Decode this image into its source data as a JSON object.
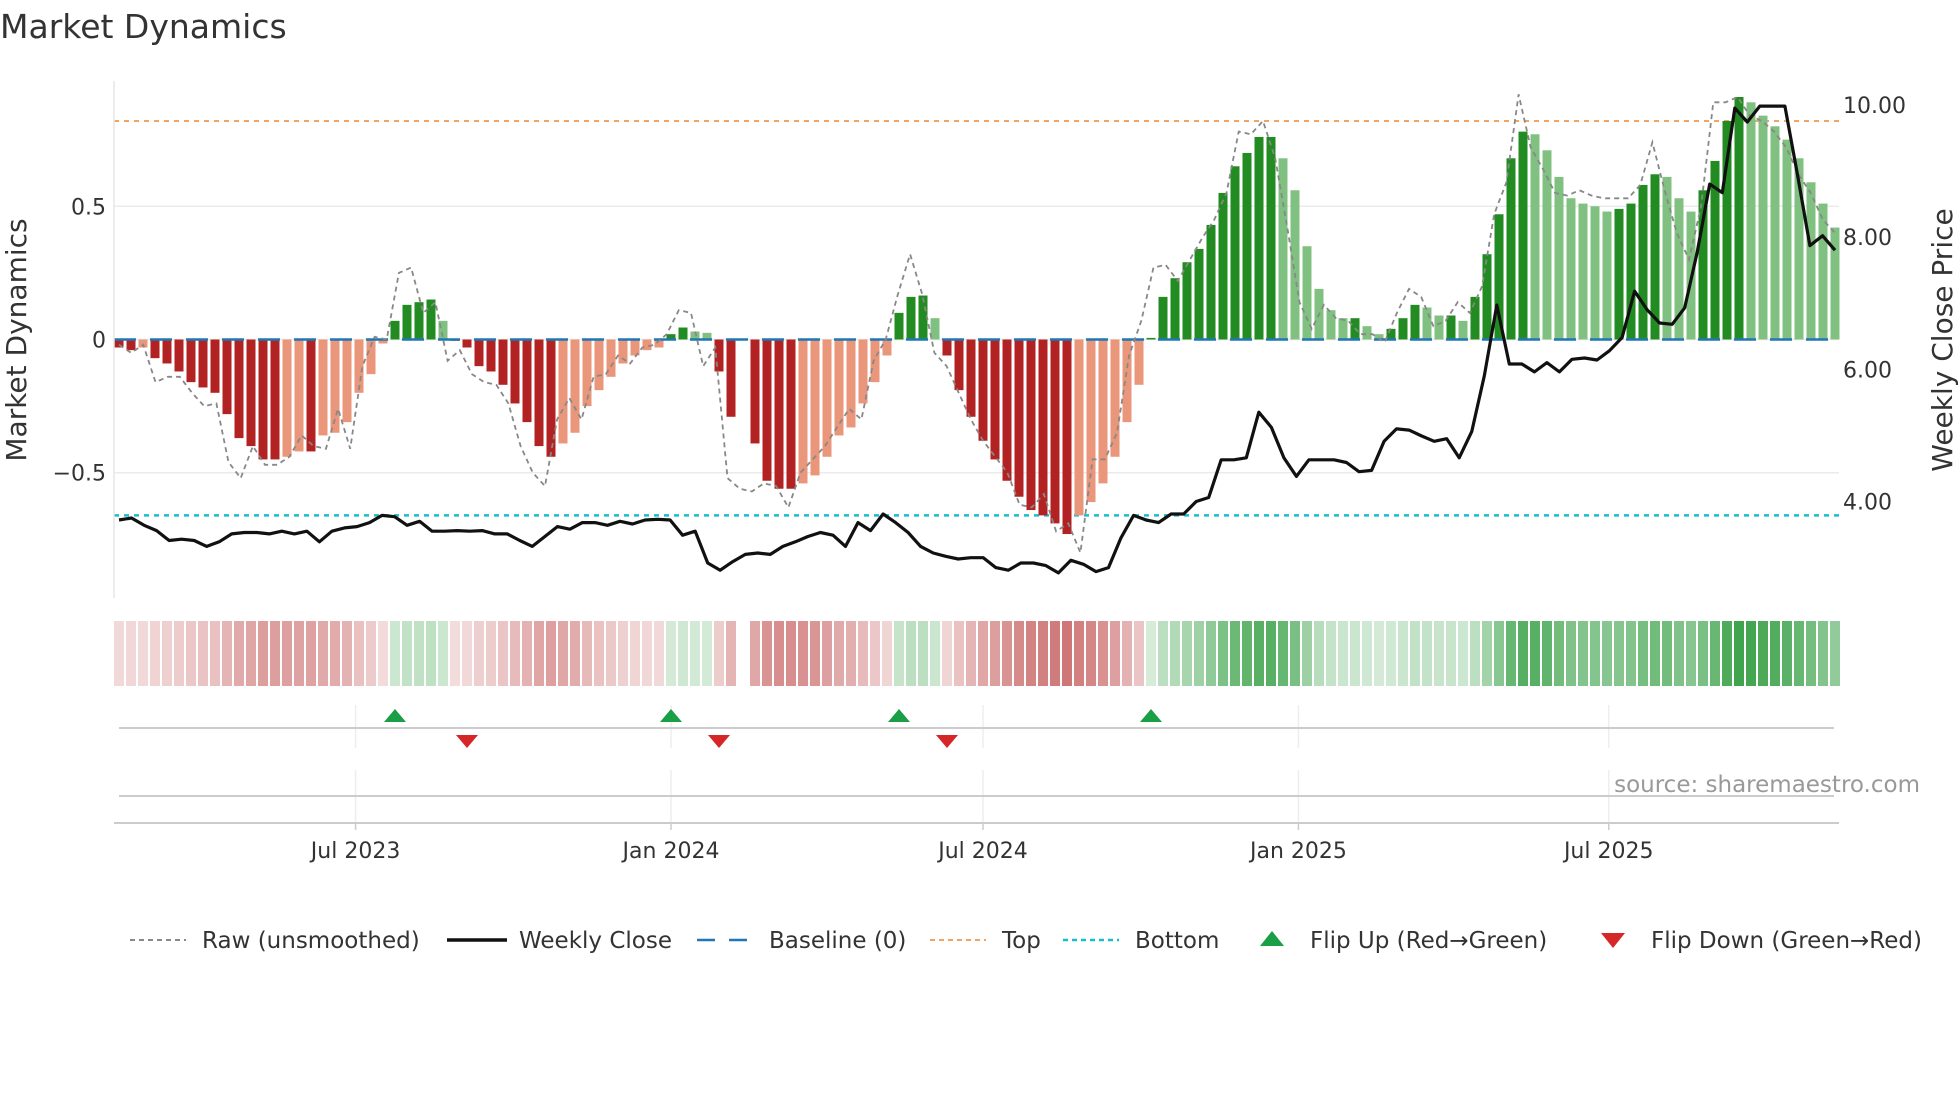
{
  "chart_data": {
    "type": "bar",
    "title": "Market Dynamics",
    "ylabel": "Market Dynamics",
    "y2label": "Weekly Close Price",
    "ylim": [
      -0.97,
      0.97
    ],
    "y2lim": [
      2.54,
      10.36
    ],
    "yticks": [
      {
        "v": 0.5,
        "label": "0.5"
      },
      {
        "v": 0,
        "label": "0"
      },
      {
        "v": -0.5,
        "label": "−0.5"
      }
    ],
    "y2ticks": [
      {
        "v": 10,
        "label": "10.00"
      },
      {
        "v": 8,
        "label": "8.00"
      },
      {
        "v": 6,
        "label": "6.00"
      },
      {
        "v": 4,
        "label": "4.00"
      }
    ],
    "start_week": "2023-02-13",
    "xticks": [
      {
        "date": "2023-07-01",
        "label": "Jul 2023"
      },
      {
        "date": "2024-01-01",
        "label": "Jan 2024"
      },
      {
        "date": "2024-07-01",
        "label": "Jul 2024"
      },
      {
        "date": "2025-01-01",
        "label": "Jan 2025"
      },
      {
        "date": "2025-07-01",
        "label": "Jul 2025"
      }
    ],
    "top_level": 0.82,
    "bottom_level": -0.66,
    "baseline": 0,
    "smoothed": [
      -0.03,
      -0.04,
      -0.03,
      -0.07,
      -0.09,
      -0.12,
      -0.16,
      -0.18,
      -0.2,
      -0.28,
      -0.37,
      -0.4,
      -0.45,
      -0.45,
      -0.44,
      -0.42,
      -0.42,
      -0.36,
      -0.35,
      -0.31,
      -0.2,
      -0.13,
      -0.015,
      0.07,
      0.13,
      0.14,
      0.15,
      0.07,
      -0.005,
      -0.03,
      -0.1,
      -0.12,
      -0.17,
      -0.24,
      -0.31,
      -0.4,
      -0.44,
      -0.39,
      -0.35,
      -0.25,
      -0.19,
      -0.14,
      -0.09,
      -0.06,
      -0.04,
      -0.03,
      0.02,
      0.045,
      0.03,
      0.025,
      -0.12,
      -0.29,
      null,
      -0.39,
      -0.53,
      -0.56,
      -0.56,
      -0.54,
      -0.51,
      -0.44,
      -0.36,
      -0.33,
      -0.24,
      -0.16,
      -0.06,
      0.1,
      0.16,
      0.165,
      0.08,
      -0.06,
      -0.19,
      -0.29,
      -0.38,
      -0.45,
      -0.53,
      -0.59,
      -0.64,
      -0.66,
      -0.69,
      -0.73,
      -0.66,
      -0.61,
      -0.54,
      -0.44,
      -0.31,
      -0.17,
      0.006,
      0.16,
      0.23,
      0.29,
      0.34,
      0.43,
      0.55,
      0.65,
      0.7,
      0.76,
      0.76,
      0.68,
      0.56,
      0.35,
      0.19,
      0.11,
      0.08,
      0.08,
      0.05,
      0.02,
      0.04,
      0.08,
      0.13,
      0.12,
      0.09,
      0.09,
      0.07,
      0.16,
      0.32,
      0.47,
      0.68,
      0.78,
      0.77,
      0.71,
      0.61,
      0.53,
      0.51,
      0.5,
      0.48,
      0.49,
      0.51,
      0.58,
      0.62,
      0.61,
      0.53,
      0.48,
      0.56,
      0.67,
      0.82,
      0.91,
      0.89,
      0.84,
      0.8,
      0.75,
      0.68,
      0.59,
      0.51,
      0.42
    ],
    "raw": [
      -0.02,
      -0.05,
      -0.02,
      -0.16,
      -0.14,
      -0.14,
      -0.2,
      -0.25,
      -0.24,
      -0.46,
      -0.52,
      -0.4,
      -0.47,
      -0.47,
      -0.44,
      -0.36,
      -0.4,
      -0.41,
      -0.26,
      -0.41,
      -0.1,
      0.01,
      0.0,
      0.25,
      0.27,
      0.1,
      0.14,
      -0.08,
      -0.04,
      -0.13,
      -0.16,
      -0.17,
      -0.24,
      -0.4,
      -0.5,
      -0.55,
      -0.3,
      -0.22,
      -0.3,
      -0.14,
      -0.13,
      -0.06,
      -0.09,
      -0.03,
      -0.02,
      0.02,
      0.11,
      0.1,
      -0.1,
      -0.03,
      -0.52,
      -0.56,
      -0.57,
      -0.54,
      -0.55,
      -0.63,
      -0.5,
      -0.45,
      -0.4,
      -0.33,
      -0.26,
      -0.3,
      -0.08,
      0.0,
      0.17,
      0.32,
      0.17,
      -0.05,
      -0.1,
      -0.2,
      -0.3,
      -0.38,
      -0.44,
      -0.5,
      -0.62,
      -0.63,
      -0.58,
      -0.72,
      -0.69,
      -0.8,
      -0.45,
      -0.45,
      -0.35,
      -0.06,
      0.07,
      0.27,
      0.28,
      0.22,
      0.3,
      0.38,
      0.45,
      0.55,
      0.78,
      0.77,
      0.82,
      0.68,
      0.42,
      0.14,
      0.04,
      0.13,
      0.08,
      0.07,
      0.02,
      0.02,
      -0.01,
      0.1,
      0.19,
      0.16,
      0.05,
      0.07,
      0.14,
      0.1,
      0.2,
      0.47,
      0.59,
      0.92,
      0.72,
      0.64,
      0.55,
      0.54,
      0.56,
      0.54,
      0.53,
      0.53,
      0.53,
      0.58,
      0.74,
      0.56,
      0.4,
      0.3,
      0.5,
      0.89,
      0.89,
      0.91,
      0.84,
      0.82,
      0.78,
      0.72,
      0.62,
      0.55,
      0.45,
      0.4
    ],
    "weekly_close": [
      3.72,
      3.75,
      3.64,
      3.56,
      3.41,
      3.43,
      3.41,
      3.32,
      3.39,
      3.51,
      3.53,
      3.53,
      3.51,
      3.55,
      3.51,
      3.55,
      3.39,
      3.55,
      3.6,
      3.62,
      3.68,
      3.79,
      3.77,
      3.64,
      3.7,
      3.55,
      3.55,
      3.56,
      3.55,
      3.56,
      3.51,
      3.51,
      3.41,
      3.32,
      3.47,
      3.62,
      3.58,
      3.68,
      3.68,
      3.64,
      3.7,
      3.66,
      3.72,
      3.73,
      3.72,
      3.49,
      3.55,
      3.07,
      2.96,
      3.09,
      3.2,
      3.22,
      3.2,
      3.32,
      3.39,
      3.47,
      3.53,
      3.49,
      3.32,
      3.68,
      3.56,
      3.81,
      3.68,
      3.53,
      3.32,
      3.22,
      3.17,
      3.13,
      3.15,
      3.15,
      3.0,
      2.96,
      3.07,
      3.07,
      3.03,
      2.92,
      3.11,
      3.05,
      2.94,
      3.0,
      3.45,
      3.79,
      3.72,
      3.68,
      3.81,
      3.81,
      4.0,
      4.06,
      4.63,
      4.63,
      4.66,
      5.35,
      5.12,
      4.66,
      4.38,
      4.63,
      4.63,
      4.63,
      4.59,
      4.45,
      4.47,
      4.91,
      5.1,
      5.08,
      4.99,
      4.91,
      4.95,
      4.66,
      5.06,
      5.9,
      6.97,
      6.08,
      6.08,
      5.96,
      6.1,
      5.96,
      6.15,
      6.17,
      6.14,
      6.28,
      6.48,
      7.18,
      6.9,
      6.7,
      6.68,
      6.93,
      7.77,
      8.8,
      8.67,
      9.95,
      9.74,
      9.98,
      9.98,
      9.98,
      8.95,
      7.87,
      8.02,
      7.8
    ],
    "flip_up": [
      "2023-07-24",
      "2024-01-01",
      "2024-05-13",
      "2024-10-07"
    ],
    "flip_down": [
      "2023-09-04",
      "2024-01-29",
      "2024-06-10"
    ],
    "colors": {
      "dark_red": "#b22222",
      "light_red": "#e9967a",
      "dark_green": "#228b22",
      "light_green": "#80c080",
      "top": "#f4a460",
      "bottom": "#17becf",
      "baseline": "#1f77b4",
      "flip_up": "#1a9e46",
      "flip_down": "#d62728"
    },
    "legend": [
      {
        "key": "raw",
        "label": "Raw (unsmoothed)"
      },
      {
        "key": "close",
        "label": "Weekly Close"
      },
      {
        "key": "baseline",
        "label": "Baseline (0)"
      },
      {
        "key": "top",
        "label": "Top"
      },
      {
        "key": "bottom",
        "label": "Bottom"
      },
      {
        "key": "flipup",
        "label": "Flip Up (Red→Green)"
      },
      {
        "key": "flipdown",
        "label": "Flip Down (Green→Red)"
      }
    ],
    "source": "source: sharemaestro.com"
  }
}
